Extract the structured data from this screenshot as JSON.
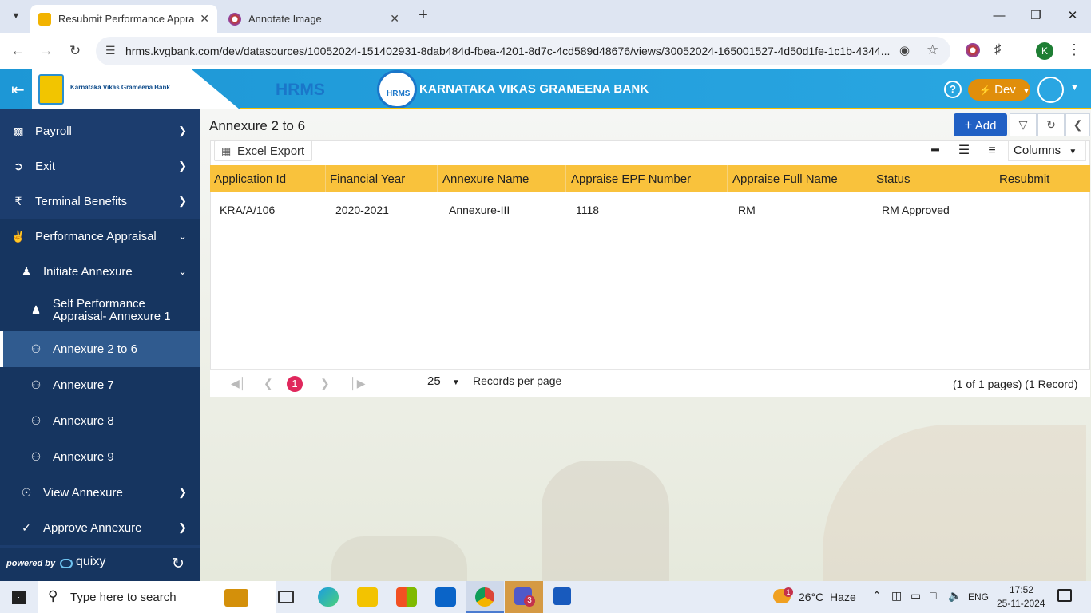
{
  "browser": {
    "tabs": [
      {
        "title": "Resubmit Performance Appraisa",
        "active": true
      },
      {
        "title": "Annotate Image",
        "active": false
      }
    ],
    "url": "hrms.kvgbank.com/dev/datasources/10052024-151402931-8dab484d-fbea-4201-8d7c-4cd589d48676/views/30052024-165001527-4d50d1fe-1c1b-4344...",
    "profile_initial": "K"
  },
  "header": {
    "app_title": "HRMS",
    "bank_name": "KARNATAKA VIKAS GRAMEENA BANK",
    "logo_text": "Karnataka Vikas Grameena Bank",
    "badge_text": "HRMS",
    "env_label": "Dev"
  },
  "sidebar": {
    "items": [
      {
        "label": "Payroll",
        "icon": "money-icon"
      },
      {
        "label": "Exit",
        "icon": "exit-icon"
      },
      {
        "label": "Terminal Benefits",
        "icon": "rupee-icon"
      },
      {
        "label": "Performance Appraisal",
        "icon": "handshake-icon"
      },
      {
        "label": "Initiate Annexure",
        "icon": "user-icon"
      },
      {
        "label": "Self Performance Appraisal- Annexure 1",
        "icon": "user-icon"
      },
      {
        "label": "Annexure 2 to 6",
        "icon": "users-icon"
      },
      {
        "label": "Annexure 7",
        "icon": "users-icon"
      },
      {
        "label": "Annexure 8",
        "icon": "users-icon"
      },
      {
        "label": "Annexure 9",
        "icon": "users-icon"
      },
      {
        "label": "View Annexure",
        "icon": "eye-icon"
      },
      {
        "label": "Approve Annexure",
        "icon": "check-icon"
      }
    ],
    "footer": {
      "powered": "powered by",
      "brand": "quixy"
    }
  },
  "main": {
    "page_title": "Annexure 2 to 6",
    "add_label": "Add",
    "excel_label": "Excel Export",
    "columns_label": "Columns",
    "table": {
      "headers": [
        "Application Id",
        "Financial Year",
        "Annexure Name",
        "Appraise EPF Number",
        "Appraise Full Name",
        "Status",
        "Resubmit"
      ],
      "rows": [
        [
          "KRA/A/106",
          "2020-2021",
          "Annexure-III",
          "1118",
          "RM",
          "RM Approved",
          ""
        ]
      ]
    },
    "pager": {
      "current_page": "1",
      "page_size": "25",
      "per_page_label": "Records per page",
      "summary": "(1 of 1 pages) (1 Record)"
    }
  },
  "taskbar": {
    "search_placeholder": "Type here to search",
    "weather": "26°C  Haze",
    "lang": "ENG",
    "time": "17:52",
    "date": "25-11-2024",
    "teams_badge": "3",
    "weather_badge": "1"
  }
}
